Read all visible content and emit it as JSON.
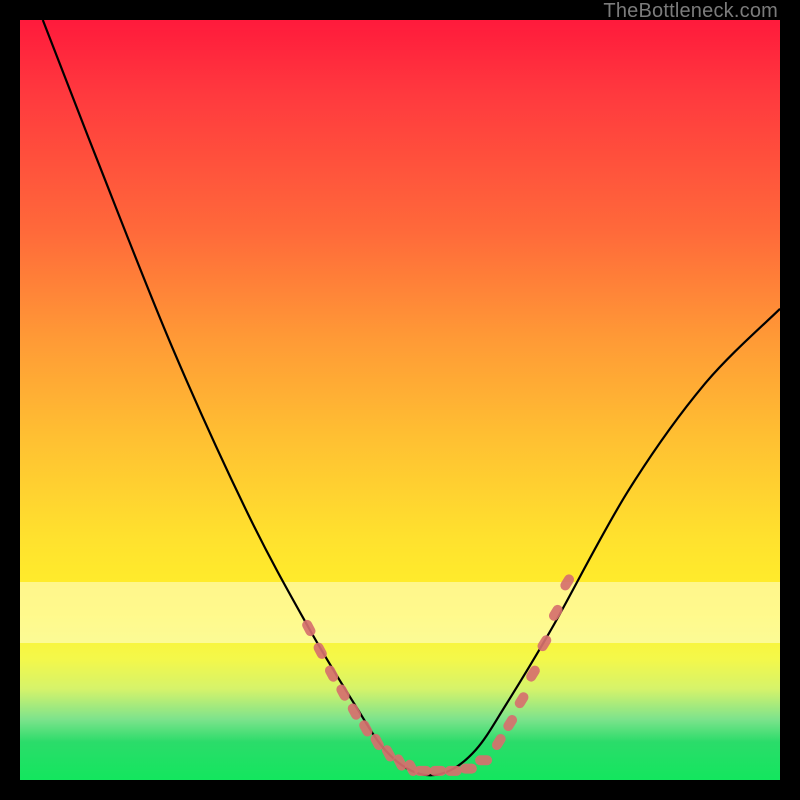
{
  "watermark": "TheBottleneck.com",
  "chart_data": {
    "type": "line",
    "title": "",
    "xlabel": "",
    "ylabel": "",
    "xlim": [
      0,
      100
    ],
    "ylim": [
      0,
      100
    ],
    "grid": false,
    "legend": false,
    "series": [
      {
        "name": "bottleneck-curve",
        "x": [
          3,
          10,
          20,
          30,
          38,
          44,
          48,
          52,
          56,
          60,
          64,
          70,
          80,
          90,
          100
        ],
        "y": [
          100,
          82,
          57,
          35,
          20,
          10,
          4,
          1,
          1,
          4,
          10,
          20,
          38,
          52,
          62
        ],
        "stroke": "#000000"
      }
    ],
    "highlight_band_y": [
      18,
      26
    ],
    "markers": {
      "name": "dotted-overlay",
      "color": "#d6706e",
      "points_left": [
        [
          38,
          20
        ],
        [
          39.5,
          17
        ],
        [
          41,
          14
        ],
        [
          42.5,
          11.5
        ],
        [
          44,
          9
        ],
        [
          45.5,
          6.8
        ],
        [
          47,
          5
        ],
        [
          48.5,
          3.5
        ],
        [
          50,
          2.3
        ],
        [
          51.5,
          1.6
        ]
      ],
      "points_floor": [
        [
          53,
          1.2
        ],
        [
          55,
          1.2
        ],
        [
          57,
          1.2
        ],
        [
          59,
          1.5
        ],
        [
          61,
          2.6
        ]
      ],
      "points_right": [
        [
          63,
          5
        ],
        [
          64.5,
          7.5
        ],
        [
          66,
          10.5
        ],
        [
          67.5,
          14
        ],
        [
          69,
          18
        ],
        [
          70.5,
          22
        ],
        [
          72,
          26
        ]
      ]
    }
  }
}
